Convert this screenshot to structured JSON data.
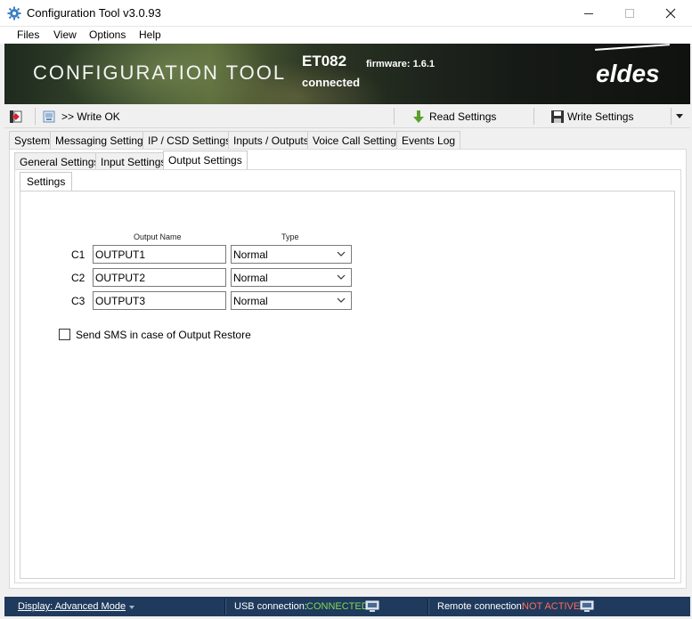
{
  "window": {
    "title": "Configuration Tool v3.0.93",
    "icon": "gear-icon"
  },
  "menu": [
    "Files",
    "View",
    "Options",
    "Help"
  ],
  "banner": {
    "product_title": "CONFIGURATION TOOL",
    "device_model": "ET082",
    "firmware": "firmware: 1.6.1",
    "connection_state": "connected",
    "logo_text": "eldes"
  },
  "toolbar": {
    "write_status": ">> Write OK",
    "read_settings_label": "Read Settings",
    "write_settings_label": "Write Settings"
  },
  "main_tabs": [
    "System",
    "Messaging Settings",
    "IP / CSD Settings",
    "Inputs / Outputs",
    "Voice Call Settings",
    "Events Log"
  ],
  "main_tab_active": "Inputs / Outputs",
  "sub_tabs": [
    "General Settings",
    "Input Settings",
    "Output Settings"
  ],
  "sub_tab_active": "Output Settings",
  "inner_tabs": [
    "Settings"
  ],
  "outputs": {
    "col_name_header": "Output Name",
    "col_type_header": "Type",
    "rows": [
      {
        "label": "C1",
        "name": "OUTPUT1",
        "type": "Normal"
      },
      {
        "label": "C2",
        "name": "OUTPUT2",
        "type": "Normal"
      },
      {
        "label": "C3",
        "name": "OUTPUT3",
        "type": "Normal"
      }
    ],
    "restore_sms_label": "Send SMS in case of Output Restore",
    "restore_sms_checked": false
  },
  "status": {
    "display_mode": "Display: Advanced Mode",
    "usb_label": "USB connection:",
    "usb_value": "CONNECTED",
    "usb_color": "#7ed957",
    "remote_label": "Remote connection:",
    "remote_value": "NOT ACTIVE",
    "remote_color": "#ff6b5b"
  }
}
